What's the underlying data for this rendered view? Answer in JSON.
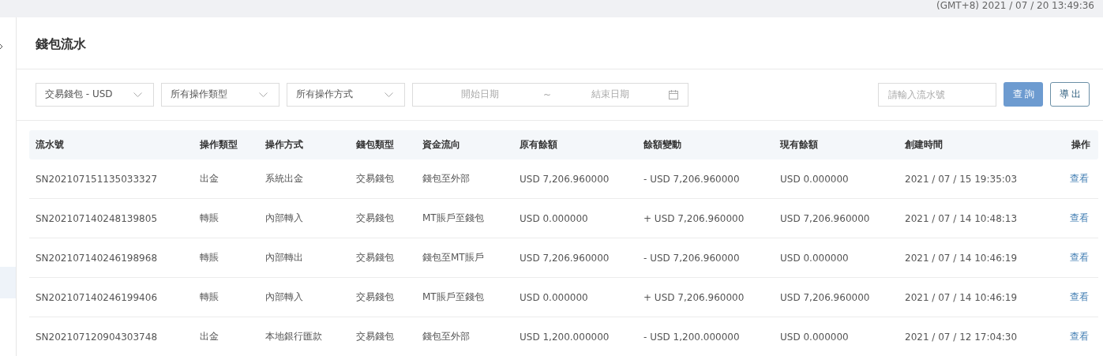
{
  "top_bar": {
    "clock": "(GMT+8) 2021 / 07 / 20 13:49:36"
  },
  "page_title": "錢包流水",
  "filters": {
    "selects": [
      {
        "value": "交易錢包 - USD",
        "placeholder_style": false
      },
      {
        "value": "所有操作類型",
        "placeholder_style": false
      },
      {
        "value": "所有操作方式",
        "placeholder_style": false
      }
    ],
    "date_range": {
      "start_placeholder": "開始日期",
      "separator": "~",
      "end_placeholder": "結束日期"
    },
    "search": {
      "placeholder": "請輸入流水號"
    },
    "buttons": [
      {
        "label": "查詢",
        "kind": "primary"
      },
      {
        "label": "導出",
        "kind": "outline"
      }
    ]
  },
  "table": {
    "columns": [
      "流水號",
      "操作類型",
      "操作方式",
      "錢包類型",
      "資金流向",
      "原有餘額",
      "餘額變動",
      "現有餘額",
      "創建時間",
      "操作"
    ],
    "rows": [
      {
        "cells": [
          "SN202107151135033327",
          "出金",
          "系統出金",
          "交易錢包",
          "錢包至外部",
          "USD 7,206.960000",
          "- USD 7,206.960000",
          "USD 0.000000",
          "2021 / 07 / 15 19:35:03"
        ],
        "action": "查看"
      },
      {
        "cells": [
          "SN202107140248139805",
          "轉賬",
          "內部轉入",
          "交易錢包",
          "MT賬戶至錢包",
          "USD 0.000000",
          "+ USD 7,206.960000",
          "USD 7,206.960000",
          "2021 / 07 / 14 10:48:13"
        ],
        "action": "查看"
      },
      {
        "cells": [
          "SN202107140246198968",
          "轉賬",
          "內部轉出",
          "交易錢包",
          "錢包至MT賬戶",
          "USD 7,206.960000",
          "- USD 7,206.960000",
          "USD 0.000000",
          "2021 / 07 / 14 10:46:19"
        ],
        "action": "查看"
      },
      {
        "cells": [
          "SN202107140246199406",
          "轉賬",
          "內部轉入",
          "交易錢包",
          "MT賬戶至錢包",
          "USD 0.000000",
          "+ USD 7,206.960000",
          "USD 7,206.960000",
          "2021 / 07 / 14 10:46:19"
        ],
        "action": "查看"
      },
      {
        "cells": [
          "SN202107120904303748",
          "出金",
          "本地銀行匯款",
          "交易錢包",
          "錢包至外部",
          "USD 1,200.000000",
          "- USD 1,200.000000",
          "USD 0.000000",
          "2021 / 07 / 12 17:04:30"
        ],
        "action": "查看"
      }
    ]
  }
}
